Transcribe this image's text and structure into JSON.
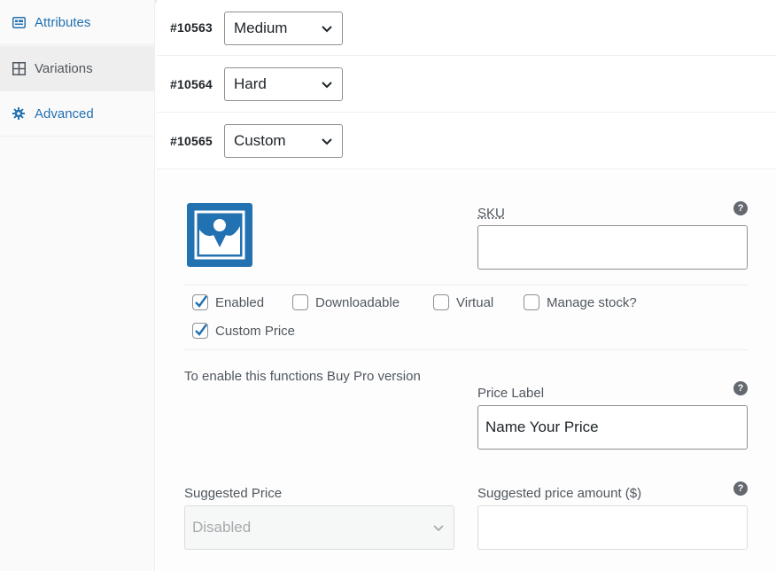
{
  "sidebar": {
    "items": [
      {
        "label": "Attributes",
        "icon": "attributes-icon"
      },
      {
        "label": "Variations",
        "icon": "grid-icon"
      },
      {
        "label": "Advanced",
        "icon": "gear-icon"
      }
    ]
  },
  "variations": [
    {
      "id": "#10563",
      "value": "Medium"
    },
    {
      "id": "#10564",
      "value": "Hard"
    },
    {
      "id": "#10565",
      "value": "Custom"
    }
  ],
  "panel": {
    "sku": {
      "label": "SKU",
      "value": ""
    },
    "checkboxes": {
      "enabled": {
        "label": "Enabled",
        "checked": true
      },
      "downloadable": {
        "label": "Downloadable",
        "checked": false
      },
      "virtual": {
        "label": "Virtual",
        "checked": false
      },
      "manage_stock": {
        "label": "Manage stock?",
        "checked": false
      },
      "custom_price": {
        "label": "Custom Price",
        "checked": true
      }
    },
    "pro_note": "To enable this functions Buy Pro version",
    "price_label": {
      "label": "Price Label",
      "value": "Name Your Price"
    },
    "suggested_price": {
      "label": "Suggested Price",
      "value": "Disabled"
    },
    "suggested_amount": {
      "label": "Suggested price amount ($)",
      "value": ""
    },
    "help_glyph": "?"
  },
  "colors": {
    "accent": "#2271b1",
    "border": "#8c8f94",
    "muted_text": "#50575e"
  }
}
